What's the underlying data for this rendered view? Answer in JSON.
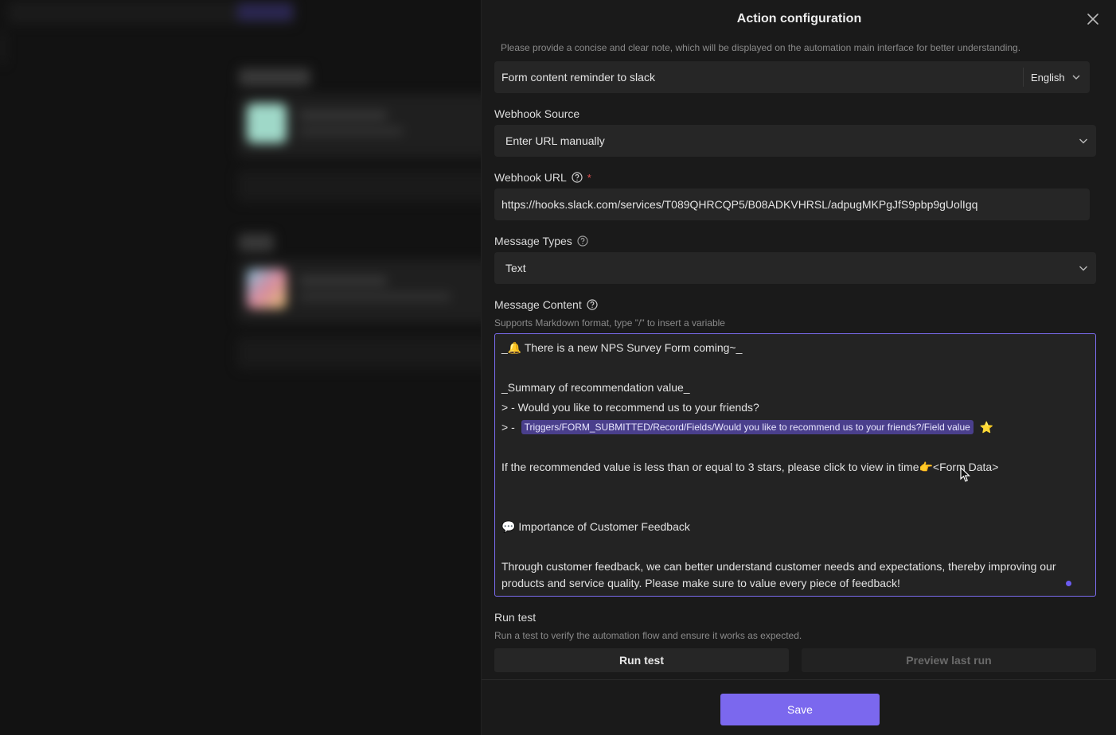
{
  "drawer": {
    "title": "Action configuration"
  },
  "note": {
    "hint": "Please provide a concise and clear note, which will be displayed on the automation main interface for better understanding.",
    "value": "Form content reminder to slack",
    "language": "English"
  },
  "webhook_source": {
    "label": "Webhook Source",
    "value": "Enter URL manually"
  },
  "webhook_url": {
    "label": "Webhook URL",
    "required_mark": "*",
    "value": "https://hooks.slack.com/services/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"
  },
  "message_types": {
    "label": "Message Types",
    "value": "Text"
  },
  "message_content": {
    "label": "Message Content",
    "hint": "Supports Markdown format, type \"/\" to insert a variable",
    "line1_prefix": "_",
    "line1_emoji": "🔔",
    "line1_text": " There is a new NPS Survey Form coming~_",
    "line2": "_Summary of recommendation value_",
    "line3": "> - Would you like to recommend us to your friends?",
    "line4_prefix": "> - ",
    "line4_variable": "Triggers/FORM_SUBMITTED/Record/Fields/Would you like to recommend us to your friends?/Field value",
    "line4_emoji": "⭐",
    "line5_text": "If the recommended value is less than or equal to 3 stars, please click to view in time",
    "line5_emoji": "👉",
    "line5_link": "<Form Data>",
    "line6_emoji": "💬",
    "line6_text": " Importance of Customer Feedback",
    "line7": "Through customer feedback, we can better understand customer needs and expectations, thereby improving our",
    "line8": "products and service quality. Please make sure to value every piece of feedback!"
  },
  "run_test": {
    "label": "Run test",
    "hint": "Run a test to verify the automation flow and ensure it works as expected.",
    "run_button": "Run test",
    "preview_button": "Preview last run"
  },
  "footer": {
    "save_label": "Save"
  },
  "colors": {
    "accent": "#7b68ee",
    "variable_tag": "#4a3f8c",
    "required": "#e25050"
  }
}
